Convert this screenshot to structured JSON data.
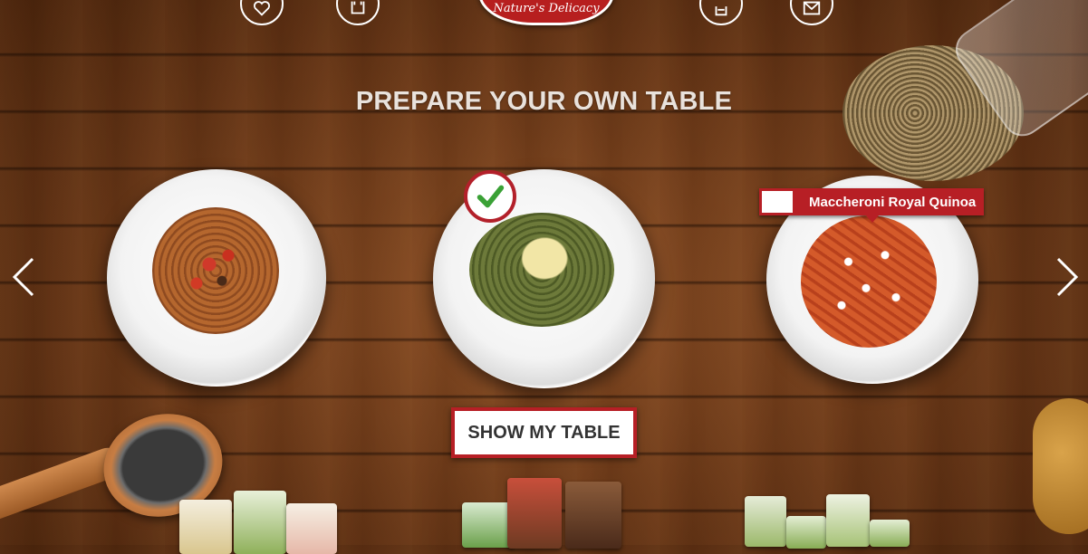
{
  "nav": {
    "icons": [
      {
        "name": "heart-icon"
      },
      {
        "name": "bag-icon"
      },
      {
        "name": "chef-hat-icon"
      },
      {
        "name": "mail-icon"
      }
    ]
  },
  "logo": {
    "tagline": "Nature's Delicacy"
  },
  "heading": "PREPARE YOUR OWN TABLE",
  "plates": [
    {
      "dish": "fusilli-tomato",
      "selected": false
    },
    {
      "dish": "green-fusilli",
      "selected": true
    },
    {
      "dish": "maccheroni-royal-quinoa",
      "selected": false
    }
  ],
  "tooltip": {
    "label": "Maccheroni Royal Quinoa"
  },
  "buttons": {
    "show_table": "SHOW MY TABLE"
  },
  "colors": {
    "brand_red": "#b71f25",
    "title": "#e9e2dc"
  }
}
